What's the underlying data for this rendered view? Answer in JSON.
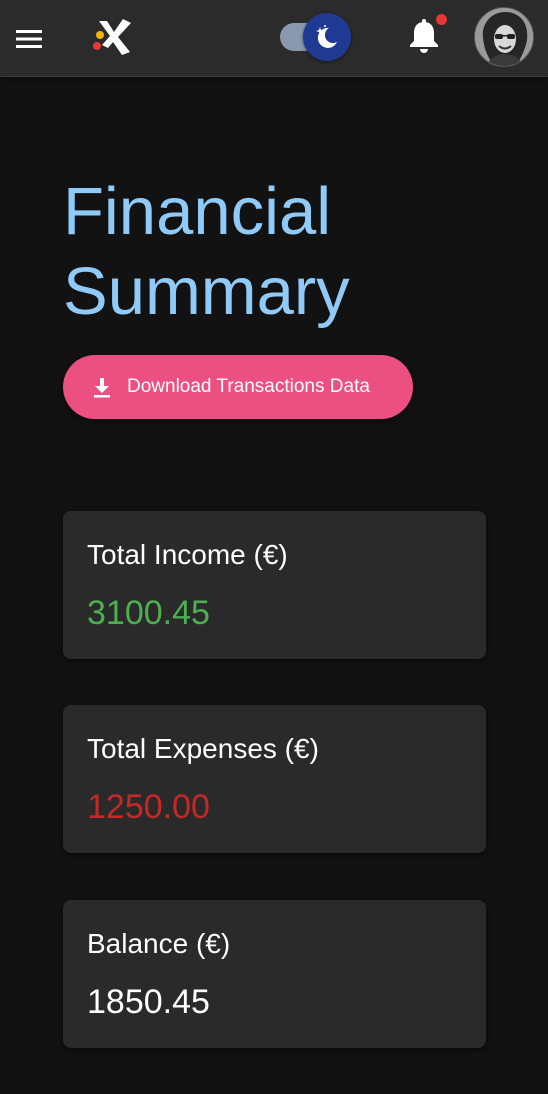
{
  "appbar": {
    "menu_icon": "menu-icon",
    "logo": "caixabank-star-logo",
    "theme_toggle": {
      "state": "dark",
      "icon": "moon-stars-icon"
    },
    "notifications": {
      "icon": "bell-icon",
      "has_unread": true
    },
    "avatar": "user-avatar"
  },
  "page": {
    "title_line1": "Financial",
    "title_line2": "Summary",
    "download_button": {
      "label": "Download Transactions Data",
      "icon": "download-icon"
    }
  },
  "cards": {
    "income": {
      "label": "Total Income (€)",
      "value": "3100.45"
    },
    "expenses": {
      "label": "Total Expenses (€)",
      "value": "1250.00"
    },
    "balance": {
      "label": "Balance (€)",
      "value": "1850.45"
    }
  },
  "colors": {
    "title": "#90caf9",
    "button": "#ec4f82",
    "income": "#4caf50",
    "expenses": "#c62828",
    "balance": "#ffffff",
    "background": "#121212",
    "card": "#2a2a2a"
  }
}
